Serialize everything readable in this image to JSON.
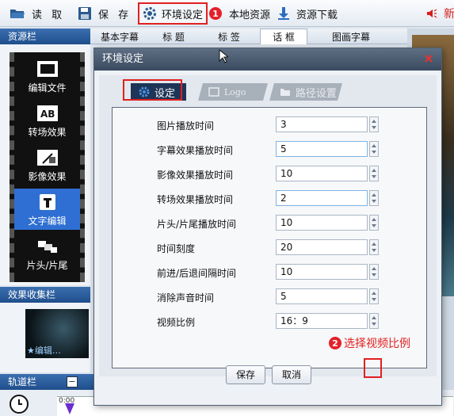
{
  "toolbar": {
    "read_label": "读 取",
    "save_label": "保 存",
    "env_label": "环境设定",
    "env_badge": "1",
    "local_label": "本地资源",
    "download_label": "资源下载",
    "new_label": "新"
  },
  "side_tabs": {
    "resource_bar": "资源栏",
    "effects_bar": "效果收集栏",
    "track_bar": "轨道栏"
  },
  "top_tabs": [
    "基本字幕",
    "标 题",
    "标 签",
    "话 框",
    "图画字幕"
  ],
  "film_items": [
    "编辑文件",
    "转场效果",
    "影像效果",
    "文字编辑",
    "片头/片尾"
  ],
  "fx_thumb_label": "★编辑…",
  "ruler_start": "0:00",
  "dialog": {
    "title": "环境设定",
    "close_symbol": "×",
    "tabs": [
      "设定",
      "Logo",
      "路径设置"
    ],
    "rows": [
      {
        "label": "图片播放时间",
        "value": "3"
      },
      {
        "label": "字幕效果播放时间",
        "value": "5"
      },
      {
        "label": "影像效果播放时间",
        "value": "10"
      },
      {
        "label": "转场效果播放时间",
        "value": "2"
      },
      {
        "label": "片头/片尾播放时间",
        "value": "10"
      },
      {
        "label": "时间刻度",
        "value": "20"
      },
      {
        "label": "前进/后退间隔时间",
        "value": "10"
      },
      {
        "label": "消除声音时间",
        "value": "5"
      },
      {
        "label": "视频比例",
        "value": "16：9"
      }
    ],
    "annotation_badge": "2",
    "annotation_text": "选择视频比例",
    "ok_label": "保存",
    "cancel_label": "取消"
  },
  "colors": {
    "accent_red": "#e02020",
    "title_bar": "#3a4a5e",
    "active_tab": "#1e3557"
  }
}
